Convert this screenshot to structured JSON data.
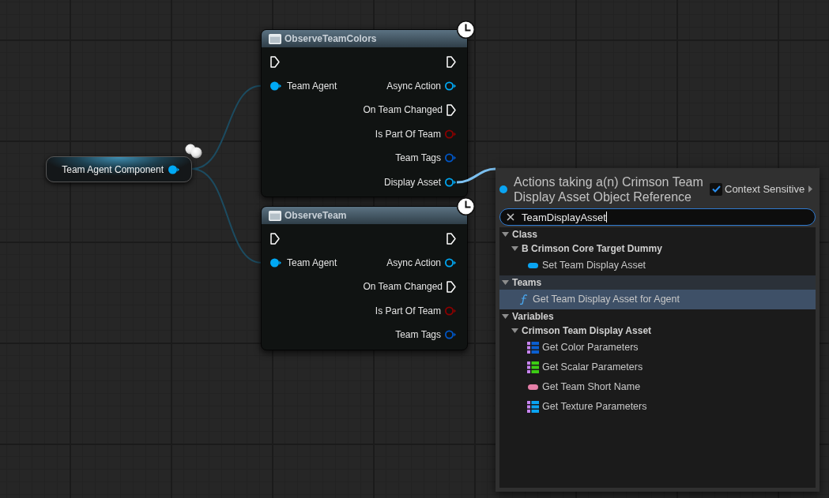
{
  "graph": {
    "nodes": [
      {
        "kind": "variable",
        "title": "Team Agent Component",
        "outputs": [
          {
            "kind": "data",
            "color": "#00a9f5",
            "connected": true
          }
        ]
      },
      {
        "kind": "async",
        "title": "ObserveTeamColors",
        "inputs": [
          {
            "kind": "exec",
            "connected": false
          },
          {
            "kind": "data",
            "label": "Team Agent",
            "color": "#00a9f5",
            "connected": true
          }
        ],
        "outputs": [
          {
            "kind": "exec",
            "connected": false
          },
          {
            "kind": "data",
            "label": "Async Action",
            "color": "#00a9f5",
            "connected": false
          },
          {
            "kind": "exec",
            "label": "On Team Changed",
            "connected": false
          },
          {
            "kind": "data",
            "label": "Is Part Of Team",
            "color": "#8c0000",
            "connected": false
          },
          {
            "kind": "data",
            "label": "Team Tags",
            "color": "#0057c8",
            "connected": false
          },
          {
            "kind": "data",
            "label": "Display Asset",
            "color": "#00a9f5",
            "connected": false
          }
        ]
      },
      {
        "kind": "async",
        "title": "ObserveTeam",
        "inputs": [
          {
            "kind": "exec",
            "connected": false
          },
          {
            "kind": "data",
            "label": "Team Agent",
            "color": "#00a9f5",
            "connected": true
          }
        ],
        "outputs": [
          {
            "kind": "exec",
            "connected": false
          },
          {
            "kind": "data",
            "label": "Async Action",
            "color": "#00a9f5",
            "connected": false
          },
          {
            "kind": "exec",
            "label": "On Team Changed",
            "connected": false
          },
          {
            "kind": "data",
            "label": "Is Part Of Team",
            "color": "#8c0000",
            "connected": false
          },
          {
            "kind": "data",
            "label": "Team Tags",
            "color": "#0057c8",
            "connected": false
          }
        ]
      }
    ]
  },
  "action_menu": {
    "title": "Actions taking a(n) Crimson Team Display Asset Object Reference",
    "context_sensitive": {
      "label": "Context Sensitive",
      "checked": true
    },
    "search": {
      "value": "TeamDisplayAsset"
    },
    "results": [
      {
        "kind": "category",
        "label": "Class",
        "expanded": true,
        "highlighted": false,
        "children": [
          {
            "kind": "category",
            "label": "B Crimson Core Target Dummy",
            "expanded": true,
            "highlighted": false,
            "children": [
              {
                "kind": "variable",
                "label": "Set Team Display Asset",
                "color": "#0aa4f2",
                "selected": false
              }
            ]
          }
        ]
      },
      {
        "kind": "category",
        "label": "Teams",
        "expanded": true,
        "highlighted": true,
        "children": [
          {
            "kind": "function",
            "label": "Get Team Display Asset for Agent",
            "color": "#4aa8f0",
            "selected": true
          }
        ]
      },
      {
        "kind": "category",
        "label": "Variables",
        "expanded": true,
        "highlighted": false,
        "children": [
          {
            "kind": "category",
            "label": "Crimson Team Display Asset",
            "expanded": true,
            "highlighted": false,
            "children": [
              {
                "kind": "array",
                "label": "Get Color Parameters",
                "color": "#0b5fd0",
                "selected": false
              },
              {
                "kind": "array",
                "label": "Get Scalar Parameters",
                "color": "#3ccc14",
                "selected": false
              },
              {
                "kind": "variable",
                "label": "Get Team Short Name",
                "color": "#e57fa8",
                "selected": false
              },
              {
                "kind": "array",
                "label": "Get Texture Parameters",
                "color": "#0aa4f2",
                "selected": false
              }
            ]
          }
        ]
      }
    ]
  }
}
